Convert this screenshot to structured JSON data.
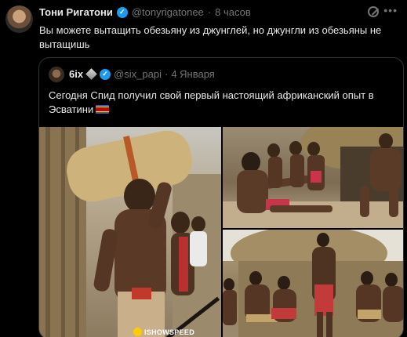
{
  "tweet": {
    "author_name": "Тони Ригатони",
    "handle": "@tonyrigatonee",
    "dot": "·",
    "time": "8 часов",
    "text": "Вы можете вытащить обезьяну из джунглей, но джунгли из обезьяны не вытащишь"
  },
  "quote": {
    "author_name": "6ix",
    "handle": "@six_papi",
    "dot": "·",
    "time": "4 Января",
    "text": "Сегодня Спид получил свой первый настоящий африканский опыт в Эсватини",
    "watermark": "ISHOWSPEED"
  },
  "colors": {
    "background": "#000000",
    "text": "#e7e9ea",
    "muted": "#71767b",
    "verified": "#1d9bf0",
    "border": "#2f3336"
  },
  "icons": [
    "verified-badge-icon",
    "grok-icon",
    "more-options-icon",
    "eswatini-flag-icon"
  ]
}
